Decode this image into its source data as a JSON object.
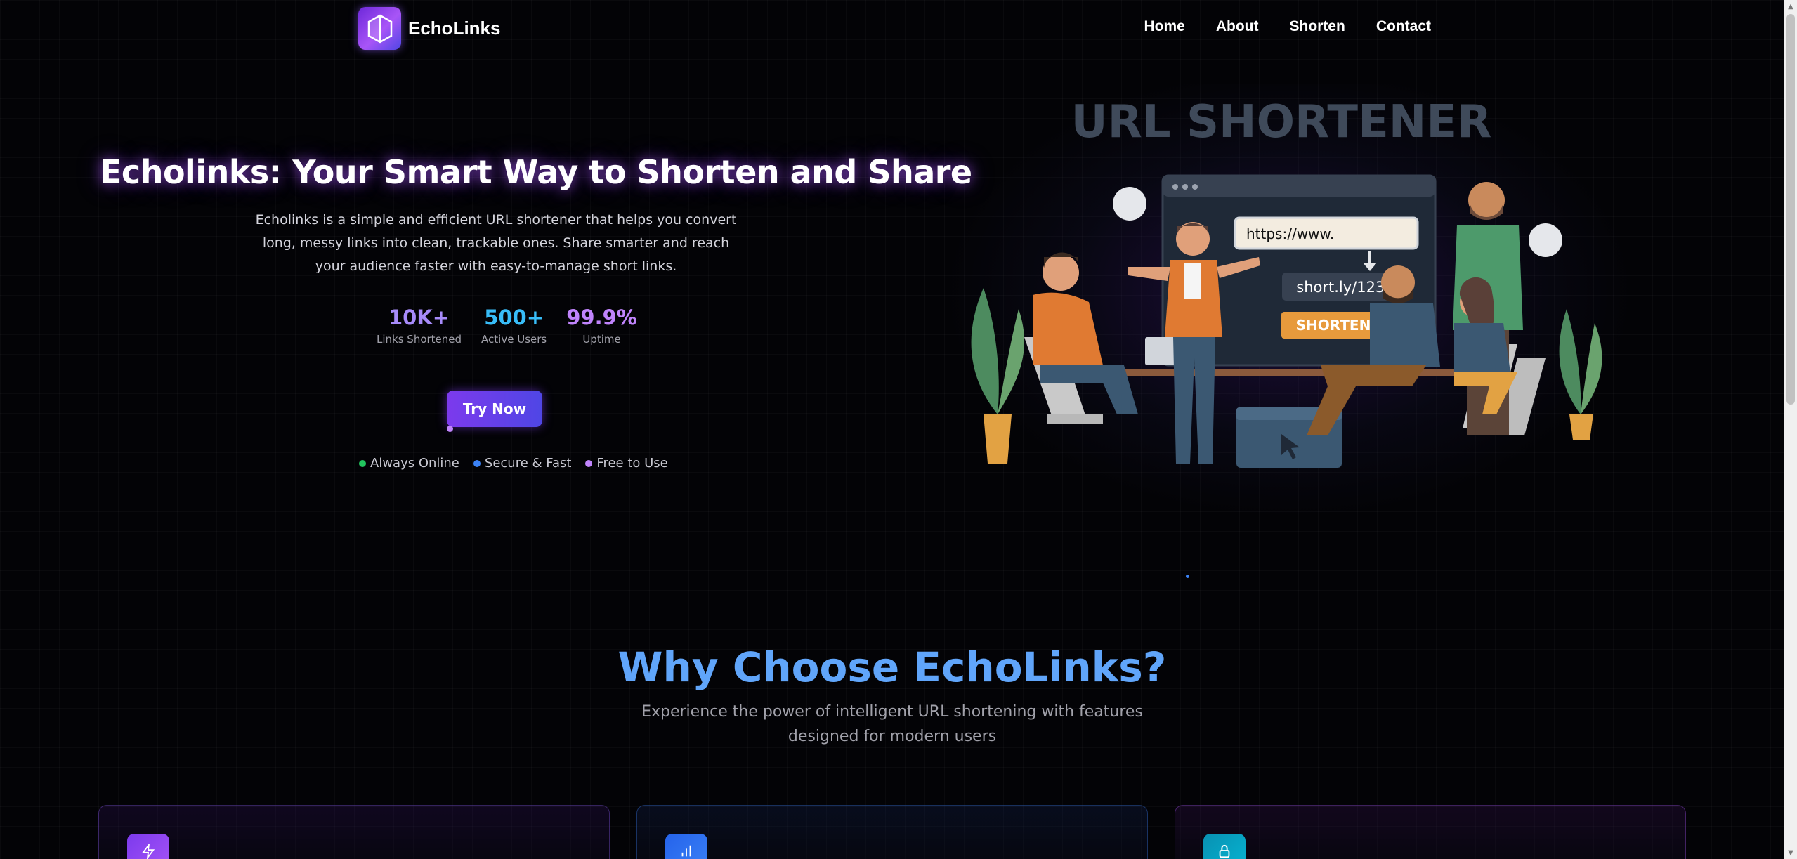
{
  "nav": {
    "brand": "EchoLinks",
    "links": [
      "Home",
      "About",
      "Shorten",
      "Contact"
    ]
  },
  "hero": {
    "title": "Echolinks: Your Smart Way to Shorten and Share",
    "description": "Echolinks is a simple and efficient URL shortener that helps you convert long, messy links into clean, trackable ones. Share smarter and reach your audience faster with easy-to-manage short links.",
    "stats": [
      {
        "value": "10K+",
        "label": "Links Shortened"
      },
      {
        "value": "500+",
        "label": "Active Users"
      },
      {
        "value": "99.9%",
        "label": "Uptime"
      }
    ],
    "cta": "Try Now",
    "features": [
      {
        "label": "Always Online",
        "color": "#22c55e"
      },
      {
        "label": "Secure & Fast",
        "color": "#3b82f6"
      },
      {
        "label": "Free to Use",
        "color": "#c084fc"
      }
    ]
  },
  "illustration": {
    "heading": "URL SHORTENER",
    "long_url": "https://www.",
    "short_url": "short.ly/1234",
    "button": "SHORTEN"
  },
  "why": {
    "title": "Why Choose EchoLinks?",
    "subtitle": "Experience the power of intelligent URL shortening with features designed for modern users",
    "cards": [
      {
        "icon": "lightning-icon"
      },
      {
        "icon": "bar-chart-icon"
      },
      {
        "icon": "lock-icon"
      }
    ]
  },
  "colors": {
    "accent_purple": "#7c3aed",
    "accent_blue": "#60a5fa",
    "background": "#030306"
  }
}
